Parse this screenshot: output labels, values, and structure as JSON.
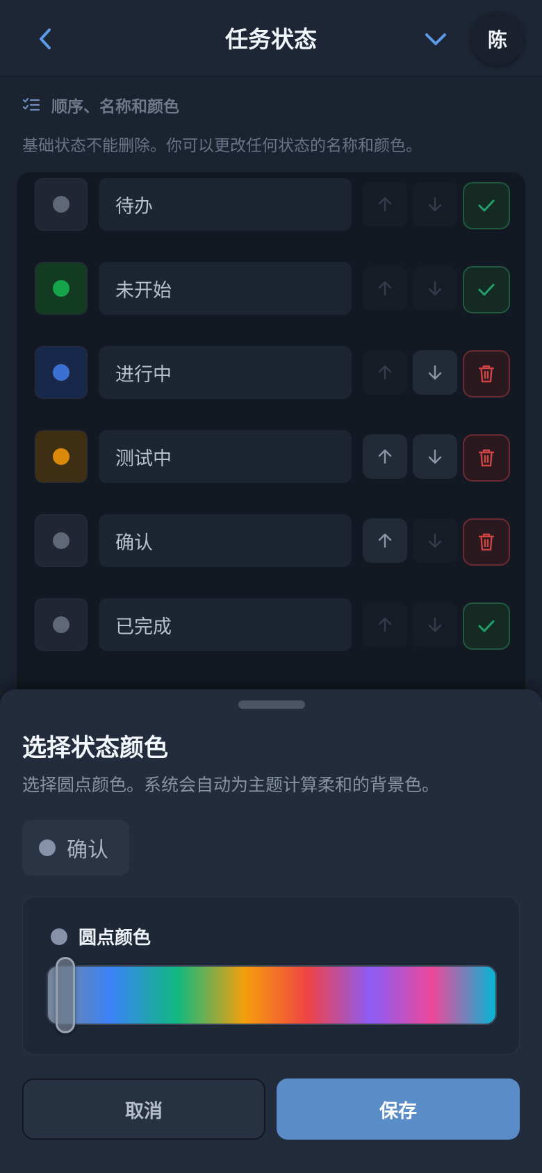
{
  "header": {
    "title": "任务状态",
    "avatar_initial": "陈"
  },
  "section": {
    "title": "顺序、名称和颜色",
    "description": "基础状态不能删除。你可以更改任何状态的名称和颜色。"
  },
  "statuses": [
    {
      "name": "待办",
      "dot_color": "#5f6878",
      "swatch_bg": "#202633",
      "action": "check",
      "up_enabled": false,
      "down_enabled": false
    },
    {
      "name": "未开始",
      "dot_color": "#16a34a",
      "swatch_bg": "#123b22",
      "action": "check",
      "up_enabled": false,
      "down_enabled": false
    },
    {
      "name": "进行中",
      "dot_color": "#3b6fd1",
      "swatch_bg": "#17284a",
      "action": "delete",
      "up_enabled": false,
      "down_enabled": true
    },
    {
      "name": "测试中",
      "dot_color": "#d98a0b",
      "swatch_bg": "#3e2f14",
      "action": "delete",
      "up_enabled": true,
      "down_enabled": true
    },
    {
      "name": "确认",
      "dot_color": "#5f6878",
      "swatch_bg": "#202633",
      "action": "delete",
      "up_enabled": true,
      "down_enabled": false
    },
    {
      "name": "已完成",
      "dot_color": "#5f6878",
      "swatch_bg": "#202633",
      "action": "check",
      "up_enabled": false,
      "down_enabled": false
    }
  ],
  "sheet": {
    "title": "选择状态颜色",
    "description": "选择圆点颜色。系统会自动为主题计算柔和的背景色。",
    "preview_label": "确认",
    "picker_label": "圆点颜色",
    "selected_color": "#8592a8",
    "hue_position_percent": 2,
    "cancel_label": "取消",
    "save_label": "保存"
  },
  "colors": {
    "accent": "#5a8cc7",
    "success_icon": "#22a06b",
    "danger_icon": "#d04444",
    "icon_blue": "#5b9be8"
  }
}
